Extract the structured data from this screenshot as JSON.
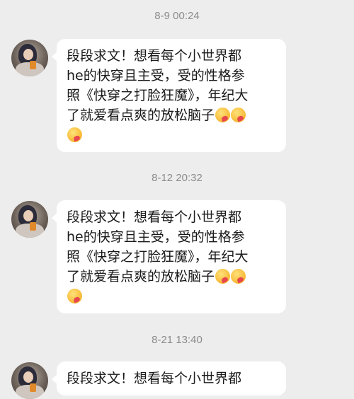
{
  "messages": [
    {
      "timestamp": "8-9 00:24",
      "lines": [
        "段段求文！想看每个小世界都",
        "he的快穿且主受，受的性格参",
        "照《快穿之打脸狂魔》，年纪大",
        "了就爱看点爽的放松脑子"
      ],
      "emoji": "heart-kiss-emoji"
    },
    {
      "timestamp": "8-12 20:32",
      "lines": [
        "段段求文！想看每个小世界都",
        "he的快穿且主受，受的性格参",
        "照《快穿之打脸狂魔》，年纪大",
        "了就爱看点爽的放松脑子"
      ],
      "emoji": "heart-kiss-emoji"
    },
    {
      "timestamp": "8-21 13:40",
      "lines": [
        "段段求文！想看每个小世界都"
      ],
      "emoji": ""
    }
  ],
  "colors": {
    "background": "#ededed",
    "bubble": "#ffffff",
    "timestamp": "#8c8c8c",
    "text": "#1a1a1a"
  }
}
